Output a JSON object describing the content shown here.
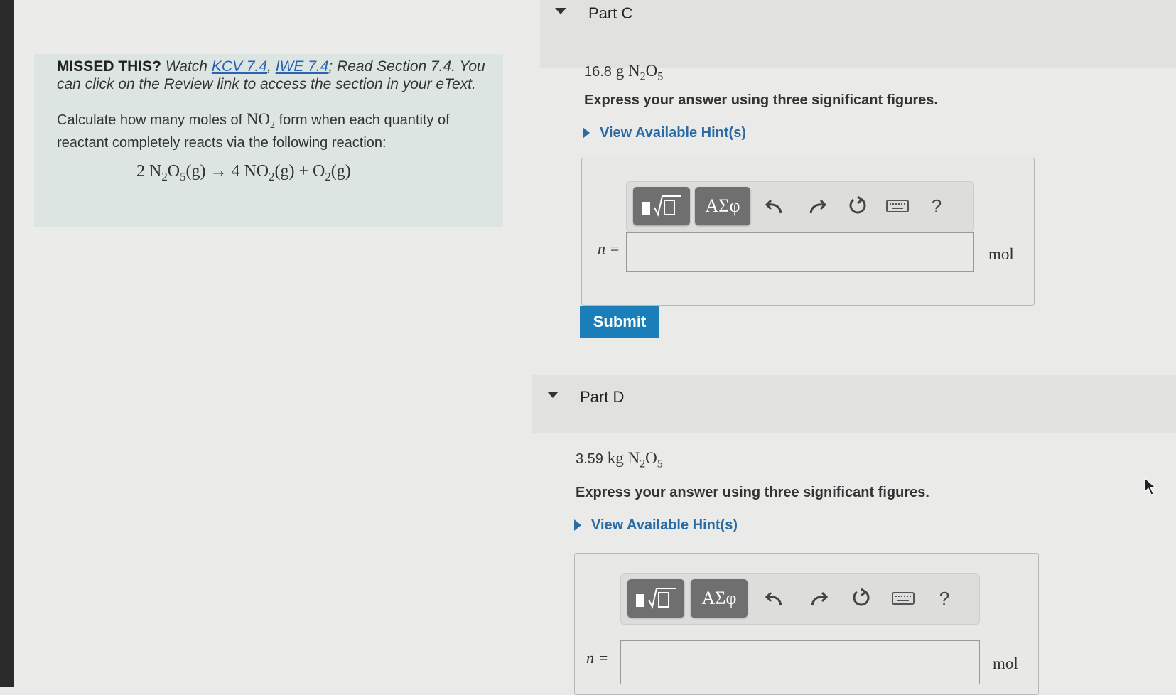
{
  "intro": {
    "missed_lead": "MISSED THIS?",
    "watch_text": " Watch ",
    "link_kcv": "KCV 7.4",
    "comma": ", ",
    "link_iwe": "IWE 7.4",
    "read_text": "; Read Section 7.4. You can click on the Review link to access the section in your eText.",
    "calc_pre": "Calculate how many moles of ",
    "calc_no": "NO",
    "calc_sub": "2",
    "calc_post": " form when each quantity of reactant completely reacts via the following reaction:",
    "equation": {
      "coef1": "2 N",
      "s1": "2",
      "t1": "O",
      "s2": "5",
      "p1": "(g) → 4 NO",
      "s3": "2",
      "p2": "(g) + O",
      "s4": "2",
      "p3": "(g)"
    }
  },
  "part_c": {
    "title": "Part C",
    "quantity_num": "16.8",
    "quantity_unit": " g N",
    "q_sub1": "2",
    "q_o": "O",
    "q_sub2": "5",
    "instruction": "Express your answer using three significant figures.",
    "hint": "View Available Hint(s)",
    "toolbar": {
      "symbols": "ΑΣφ",
      "help": "?"
    },
    "var_label": "n =",
    "input_value": "",
    "unit": "mol",
    "submit": "Submit"
  },
  "part_d": {
    "title": "Part D",
    "quantity_num": "3.59",
    "quantity_unit": " kg N",
    "q_sub1": "2",
    "q_o": "O",
    "q_sub2": "5",
    "instruction": "Express your answer using three significant figures.",
    "hint": "View Available Hint(s)",
    "toolbar": {
      "symbols": "ΑΣφ",
      "help": "?"
    },
    "var_label": "n =",
    "input_value": "",
    "unit": "mol"
  }
}
